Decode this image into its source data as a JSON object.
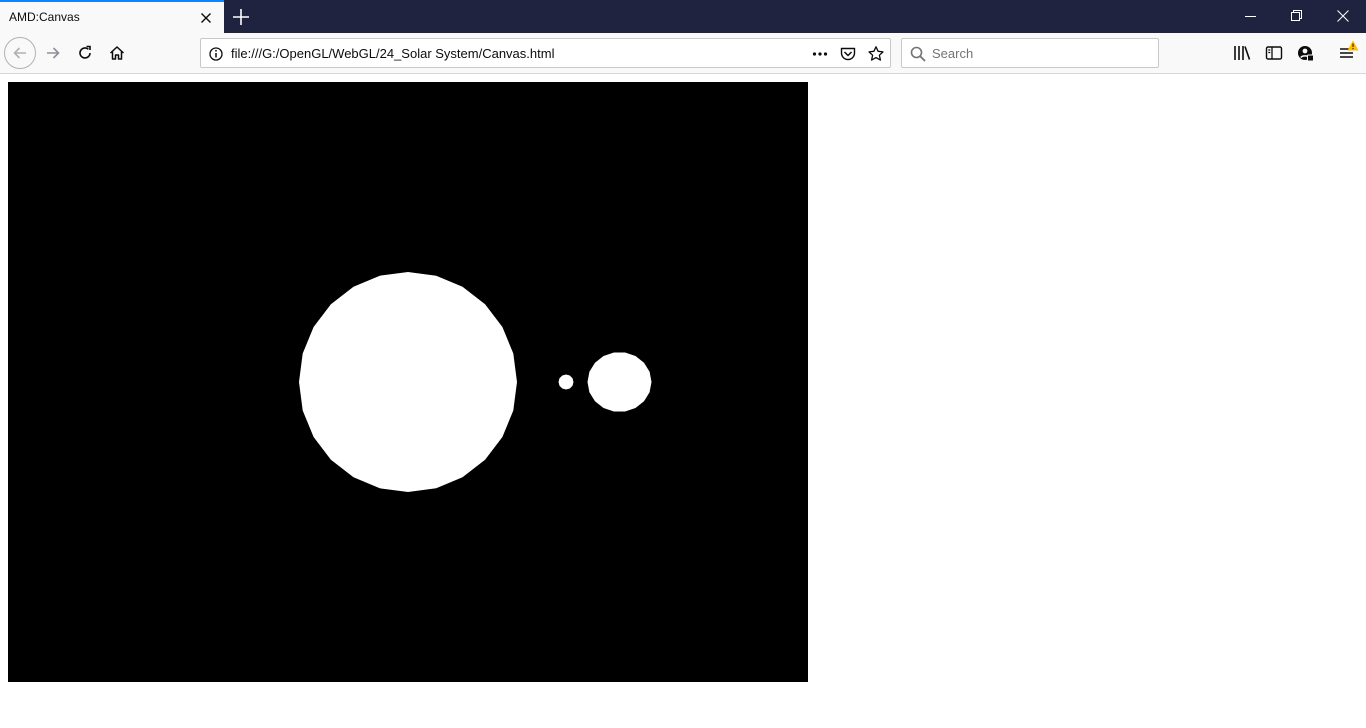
{
  "browser": {
    "tab": {
      "title": "AMD:Canvas"
    },
    "urlbar": {
      "url": "file:///G:/OpenGL/WebGL/24_Solar System/Canvas.html"
    },
    "search": {
      "placeholder": "Search"
    }
  },
  "icons": {
    "tab_close": "close-icon",
    "new_tab": "plus-icon",
    "minimize": "minimize-icon",
    "restore": "restore-icon",
    "close_window": "close-icon",
    "back": "arrow-left-icon",
    "forward": "arrow-right-icon",
    "reload": "reload-icon",
    "home": "home-icon",
    "site_info": "info-icon",
    "page_actions": "more-icon",
    "pocket": "pocket-icon",
    "bookmark": "star-icon",
    "search": "search-icon",
    "library": "library-icon",
    "sidebar": "sidebar-icon",
    "account": "account-icon",
    "menu": "hamburger-menu-icon",
    "warning": "warning-icon"
  },
  "colors": {
    "titlebar": "#202340",
    "tab_accent": "#0a84ff",
    "toolbar": "#f9f9fa",
    "canvas_background": "#000000",
    "bodies": "#ffffff",
    "warning": "#ffbf00"
  }
}
